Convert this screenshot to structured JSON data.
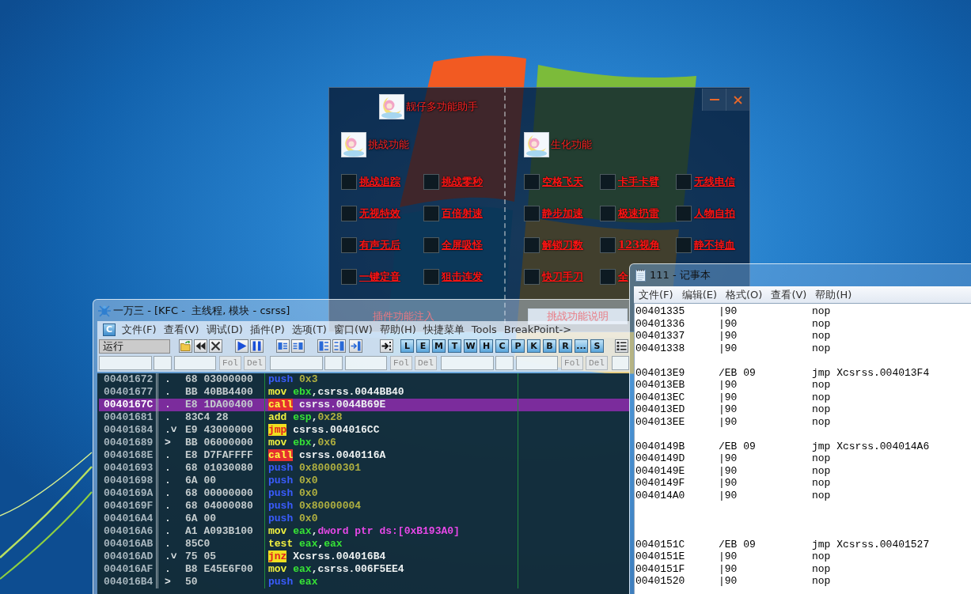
{
  "helper_window": {
    "title": "靓仔多功能助手",
    "sections": [
      {
        "title": "挑战功能",
        "rows": [
          [
            {
              "label": "挑战追踪",
              "checked": false
            },
            {
              "label": "挑战零秒",
              "checked": false
            }
          ],
          [
            {
              "label": "无视特效",
              "checked": false
            },
            {
              "label": "百倍射速",
              "checked": false
            }
          ],
          [
            {
              "label": "有声无后",
              "checked": false
            },
            {
              "label": "全屏吸怪",
              "checked": false
            }
          ],
          [
            {
              "label": "一键定音",
              "checked": false
            },
            {
              "label": "狙击连发",
              "checked": false
            }
          ]
        ]
      },
      {
        "title": "生化功能",
        "rows": [
          [
            {
              "label": "空格飞天",
              "checked": false
            },
            {
              "label": "卡手卡臂",
              "checked": false
            },
            {
              "label": "无线电信",
              "checked": false
            }
          ],
          [
            {
              "label": "静步加速",
              "checked": false
            },
            {
              "label": "极速扔雷",
              "checked": false
            },
            {
              "label": "人物自拍",
              "checked": false
            }
          ],
          [
            {
              "label": "解锁刀数",
              "checked": false
            },
            {
              "label": "123视角",
              "checked": false
            },
            {
              "label": "静不掉血",
              "checked": false
            }
          ],
          [
            {
              "label": "快刀手刀",
              "checked": false
            },
            {
              "label": "全",
              "checked": false
            }
          ]
        ]
      }
    ],
    "buttons": [
      {
        "label": "插件功能注入",
        "kind": "flat"
      },
      {
        "label": "挑战功能说明",
        "kind": "raised"
      }
    ]
  },
  "debugger_window": {
    "title": "一万三 - [KFC -  主线程, 模块 - csrss]",
    "window_menu": "C",
    "menus": [
      "文件(F)",
      "查看(V)",
      "调试(D)",
      "插件(P)",
      "选项(T)",
      "窗口(W)",
      "帮助(H)",
      "快捷菜单",
      "Tools",
      "BreakPoint->"
    ],
    "status": "运行",
    "tool_letters": [
      "L",
      "E",
      "M",
      "T",
      "W",
      "H",
      "C",
      "P",
      "K",
      "B",
      "R",
      "...",
      "S"
    ],
    "find_bars": [
      {
        "buttons": [
          "Fol",
          "Del"
        ]
      },
      {
        "buttons": [
          "Fol",
          "Del"
        ]
      },
      {
        "buttons": [
          "Fol",
          "Del"
        ]
      }
    ],
    "rows": [
      {
        "address": "00401672",
        "marker": ".",
        "bytes": "68 03000000",
        "mnemonic": {
          "text": "push",
          "kind": "stack"
        },
        "operands": [
          {
            "text": "0x3",
            "kind": "constant"
          }
        ],
        "selected": false
      },
      {
        "address": "00401677",
        "marker": ".",
        "bytes": "BB 40BB4400",
        "mnemonic": {
          "text": "mov",
          "kind": "general"
        },
        "operands": [
          {
            "text": "ebx",
            "kind": "register"
          },
          {
            "text": ",csrss.0044BB40",
            "kind": "plain"
          }
        ],
        "selected": false
      },
      {
        "address": "0040167C",
        "marker": ".",
        "bytes": "E8 1DA00400",
        "mnemonic": {
          "text": "call",
          "kind": "call"
        },
        "operands": [
          {
            "text": "csrss.0044B69E",
            "kind": "plain"
          }
        ],
        "selected": true
      },
      {
        "address": "00401681",
        "marker": ".",
        "bytes": "83C4 28",
        "mnemonic": {
          "text": "add",
          "kind": "general"
        },
        "operands": [
          {
            "text": "esp",
            "kind": "register"
          },
          {
            "text": ",",
            "kind": "plain"
          },
          {
            "text": "0x28",
            "kind": "constant"
          }
        ],
        "selected": false
      },
      {
        "address": "00401684",
        "marker": ".˅",
        "bytes": "E9 43000000",
        "mnemonic": {
          "text": "jmp",
          "kind": "jump"
        },
        "operands": [
          {
            "text": "csrss.004016CC",
            "kind": "plain"
          }
        ],
        "selected": false
      },
      {
        "address": "00401689",
        "marker": ">",
        "bytes": "BB 06000000",
        "mnemonic": {
          "text": "mov",
          "kind": "general"
        },
        "operands": [
          {
            "text": "ebx",
            "kind": "register"
          },
          {
            "text": ",",
            "kind": "plain"
          },
          {
            "text": "0x6",
            "kind": "constant"
          }
        ],
        "selected": false
      },
      {
        "address": "0040168E",
        "marker": ".",
        "bytes": "E8 D7FAFFFF",
        "mnemonic": {
          "text": "call",
          "kind": "call"
        },
        "operands": [
          {
            "text": "csrss.0040116A",
            "kind": "plain"
          }
        ],
        "selected": false
      },
      {
        "address": "00401693",
        "marker": ".",
        "bytes": "68 01030080",
        "mnemonic": {
          "text": "push",
          "kind": "stack"
        },
        "operands": [
          {
            "text": "0x80000301",
            "kind": "constant"
          }
        ],
        "selected": false
      },
      {
        "address": "00401698",
        "marker": ".",
        "bytes": "6A 00",
        "mnemonic": {
          "text": "push",
          "kind": "stack"
        },
        "operands": [
          {
            "text": "0x0",
            "kind": "constant"
          }
        ],
        "selected": false
      },
      {
        "address": "0040169A",
        "marker": ".",
        "bytes": "68 00000000",
        "mnemonic": {
          "text": "push",
          "kind": "stack"
        },
        "operands": [
          {
            "text": "0x0",
            "kind": "constant"
          }
        ],
        "selected": false
      },
      {
        "address": "0040169F",
        "marker": ".",
        "bytes": "68 04000080",
        "mnemonic": {
          "text": "push",
          "kind": "stack"
        },
        "operands": [
          {
            "text": "0x80000004",
            "kind": "constant"
          }
        ],
        "selected": false
      },
      {
        "address": "004016A4",
        "marker": ".",
        "bytes": "6A 00",
        "mnemonic": {
          "text": "push",
          "kind": "stack"
        },
        "operands": [
          {
            "text": "0x0",
            "kind": "constant"
          }
        ],
        "selected": false
      },
      {
        "address": "004016A6",
        "marker": ".",
        "bytes": "A1 A093B100",
        "mnemonic": {
          "text": "mov",
          "kind": "general"
        },
        "operands": [
          {
            "text": "eax",
            "kind": "register"
          },
          {
            "text": ",",
            "kind": "plain"
          },
          {
            "text": "dword ptr ds:[0xB193A0]",
            "kind": "memory"
          }
        ],
        "selected": false
      },
      {
        "address": "004016AB",
        "marker": ".",
        "bytes": "85C0",
        "mnemonic": {
          "text": "test",
          "kind": "general"
        },
        "operands": [
          {
            "text": "eax",
            "kind": "register"
          },
          {
            "text": ",",
            "kind": "plain"
          },
          {
            "text": "eax",
            "kind": "register"
          }
        ],
        "selected": false
      },
      {
        "address": "004016AD",
        "marker": ".˅",
        "bytes": "75 05",
        "mnemonic": {
          "text": "jnz",
          "kind": "jump"
        },
        "operands": [
          {
            "text": "Xcsrss.004016B4",
            "kind": "plain"
          }
        ],
        "selected": false
      },
      {
        "address": "004016AF",
        "marker": ".",
        "bytes": "B8 E45E6F00",
        "mnemonic": {
          "text": "mov",
          "kind": "general"
        },
        "operands": [
          {
            "text": "eax",
            "kind": "register"
          },
          {
            "text": ",csrss.006F5EE4",
            "kind": "plain"
          }
        ],
        "selected": false
      },
      {
        "address": "004016B4",
        "marker": ">",
        "bytes": "50",
        "mnemonic": {
          "text": "push",
          "kind": "stack"
        },
        "operands": [
          {
            "text": "eax",
            "kind": "register"
          }
        ],
        "selected": false
      }
    ]
  },
  "notepad_window": {
    "title": "111 - 记事本",
    "menus": [
      "文件(F)",
      "编辑(E)",
      "格式(O)",
      "查看(V)",
      "帮助(H)"
    ],
    "lines": [
      {
        "kind": "code",
        "address": "00401335",
        "bytes": "|90",
        "instruction": "nop"
      },
      {
        "kind": "code",
        "address": "00401336",
        "bytes": "|90",
        "instruction": "nop"
      },
      {
        "kind": "code",
        "address": "00401337",
        "bytes": "|90",
        "instruction": "nop"
      },
      {
        "kind": "code",
        "address": "00401338",
        "bytes": "|90",
        "instruction": "nop"
      },
      {
        "kind": "blank"
      },
      {
        "kind": "code",
        "address": "004013E9",
        "bytes": "/EB 09",
        "instruction": "jmp Xcsrss.004013F4"
      },
      {
        "kind": "code",
        "address": "004013EB",
        "bytes": "|90",
        "instruction": "nop"
      },
      {
        "kind": "code",
        "address": "004013EC",
        "bytes": "|90",
        "instruction": "nop"
      },
      {
        "kind": "code",
        "address": "004013ED",
        "bytes": "|90",
        "instruction": "nop"
      },
      {
        "kind": "code",
        "address": "004013EE",
        "bytes": "|90",
        "instruction": "nop"
      },
      {
        "kind": "blank"
      },
      {
        "kind": "code",
        "address": "0040149B",
        "bytes": "/EB 09",
        "instruction": "jmp Xcsrss.004014A6"
      },
      {
        "kind": "code",
        "address": "0040149D",
        "bytes": "|90",
        "instruction": "nop"
      },
      {
        "kind": "code",
        "address": "0040149E",
        "bytes": "|90",
        "instruction": "nop"
      },
      {
        "kind": "code",
        "address": "0040149F",
        "bytes": "|90",
        "instruction": "nop"
      },
      {
        "kind": "code",
        "address": "004014A0",
        "bytes": "|90",
        "instruction": "nop"
      },
      {
        "kind": "blank"
      },
      {
        "kind": "blank"
      },
      {
        "kind": "blank"
      },
      {
        "kind": "code",
        "address": "0040151C",
        "bytes": "/EB 09",
        "instruction": "jmp Xcsrss.00401527"
      },
      {
        "kind": "code",
        "address": "0040151E",
        "bytes": "|90",
        "instruction": "nop"
      },
      {
        "kind": "code",
        "address": "0040151F",
        "bytes": "|90",
        "instruction": "nop"
      },
      {
        "kind": "code",
        "address": "00401520",
        "bytes": "|90",
        "instruction": "nop"
      }
    ]
  }
}
